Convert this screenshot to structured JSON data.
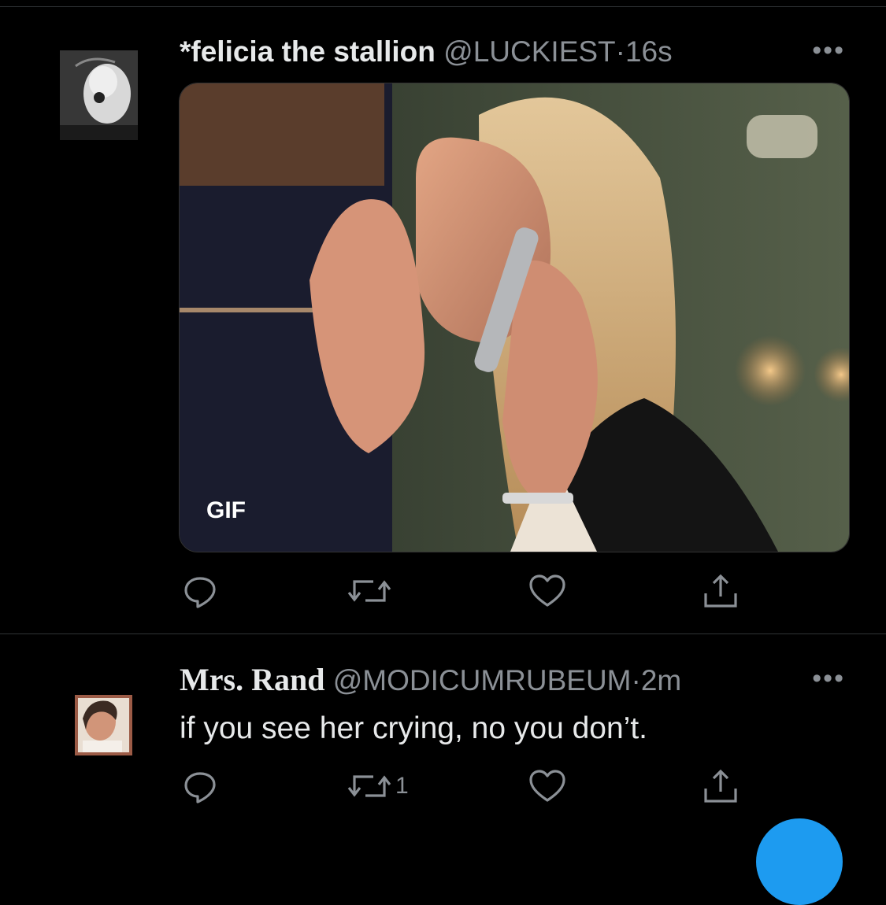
{
  "tweets": [
    {
      "display_name": "*felicia the stallion",
      "handle": "@LUCKIEST",
      "separator": "·",
      "time": "16s",
      "more": "•••",
      "media_badge": "GIF",
      "actions": {
        "reply_count": "",
        "retweet_count": "",
        "like_count": ""
      }
    },
    {
      "display_name": "Mrs. Rand",
      "handle": "@MODICUMRUBEUM",
      "separator": "·",
      "time": "2m",
      "more": "•••",
      "text": "if you see her crying, no you don’t.",
      "actions": {
        "reply_count": "",
        "retweet_count": "1",
        "like_count": ""
      }
    }
  ],
  "icons": [
    "reply-icon",
    "retweet-icon",
    "like-icon",
    "share-icon",
    "more-icon"
  ],
  "colors": {
    "background": "#000000",
    "secondary_text": "#8b9096",
    "divider": "#2f3336",
    "accent": "#1d9bf0"
  }
}
